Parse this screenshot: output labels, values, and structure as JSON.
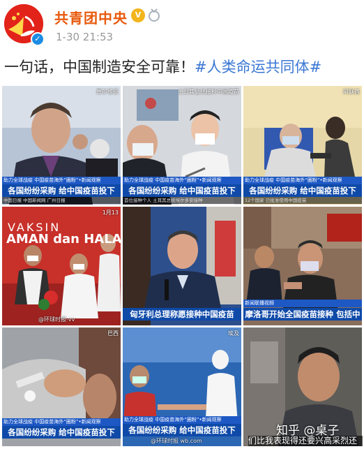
{
  "post": {
    "username": "共青团中央",
    "timestamp": "1-30 21:53",
    "text": "一句话，中国制造安全可靠！",
    "hashtag": "#人类命运共同体#",
    "badge_gold": "V"
  },
  "grid": {
    "cells": [
      {
        "caption": "各国纷纷采购 给中国疫苗投下",
        "topstrip": "助力全球战疫 中国疫苗海外“圈粉”•新闻观察",
        "subline": "中国日报 中国新闻网 广州日报",
        "corner": "塞尔维亚",
        "bg": "#4a5f7a"
      },
      {
        "caption": "各国纷纷采购 给中国疫苗投下",
        "topstrip": "助力全球战疫 中国疫苗海外“圈粉”•新闻观察",
        "subline": "首位接种个人 土耳其总统埃尔多安接种",
        "corner": "土耳其总统接种中国疫苗",
        "bg": "#c7c9cc"
      },
      {
        "caption": "各国纷纷采购 给中国疫苗投下",
        "topstrip": "助力全球战疫 中国疫苗海外“圈粉”•新闻观察",
        "subline": "12个国家 已批准使用中国疫苗",
        "corner": "阿联酋",
        "bg": "#3a5ea8"
      },
      {
        "caption": "",
        "topstrip": "",
        "subline": "",
        "corner": "1月13",
        "bg": "#c8302a",
        "watermark": "@环球时报-vv"
      },
      {
        "caption": "匈牙利总理称愿接种中国疫苗",
        "topstrip": "",
        "subline": "",
        "corner": "",
        "bg": "#2d4f8c",
        "watermark": ""
      },
      {
        "caption": "摩洛哥开始全国疫苗接种 包括中",
        "topstrip": "新闻联播视频",
        "subline": "",
        "corner": "",
        "bg": "#7a2a24",
        "watermark": ""
      },
      {
        "caption": "各国纷纷采购 给中国疫苗投下",
        "topstrip": "助力全球战疫 中国疫苗海外“圈粉”•新闻观察",
        "subline": "",
        "corner": "巴西",
        "bg": "#8a8e93"
      },
      {
        "caption": "各国纷纷采购 给中国疫苗投下",
        "topstrip": "助力全球战疫 中国疫苗海外“圈粉”•新闻观察",
        "subline": "",
        "corner": "埃及",
        "bg": "#2c67b4",
        "watermark": "@环球时报 wb.com"
      },
      {
        "caption": "",
        "topstrip": "",
        "subline": "",
        "corner": "",
        "bg": "#5f5d58"
      }
    ],
    "vaksin": "VAKSIN",
    "aman": "AMAN dan HALAL"
  },
  "overlays": {
    "zhihu": "知乎 @桌子",
    "bottom": "们比我表现得还要兴高采烈还"
  },
  "colors": {
    "username": "#e8590c",
    "hashtag": "#3b77d4",
    "caption_bg": "#0f4aa8"
  }
}
